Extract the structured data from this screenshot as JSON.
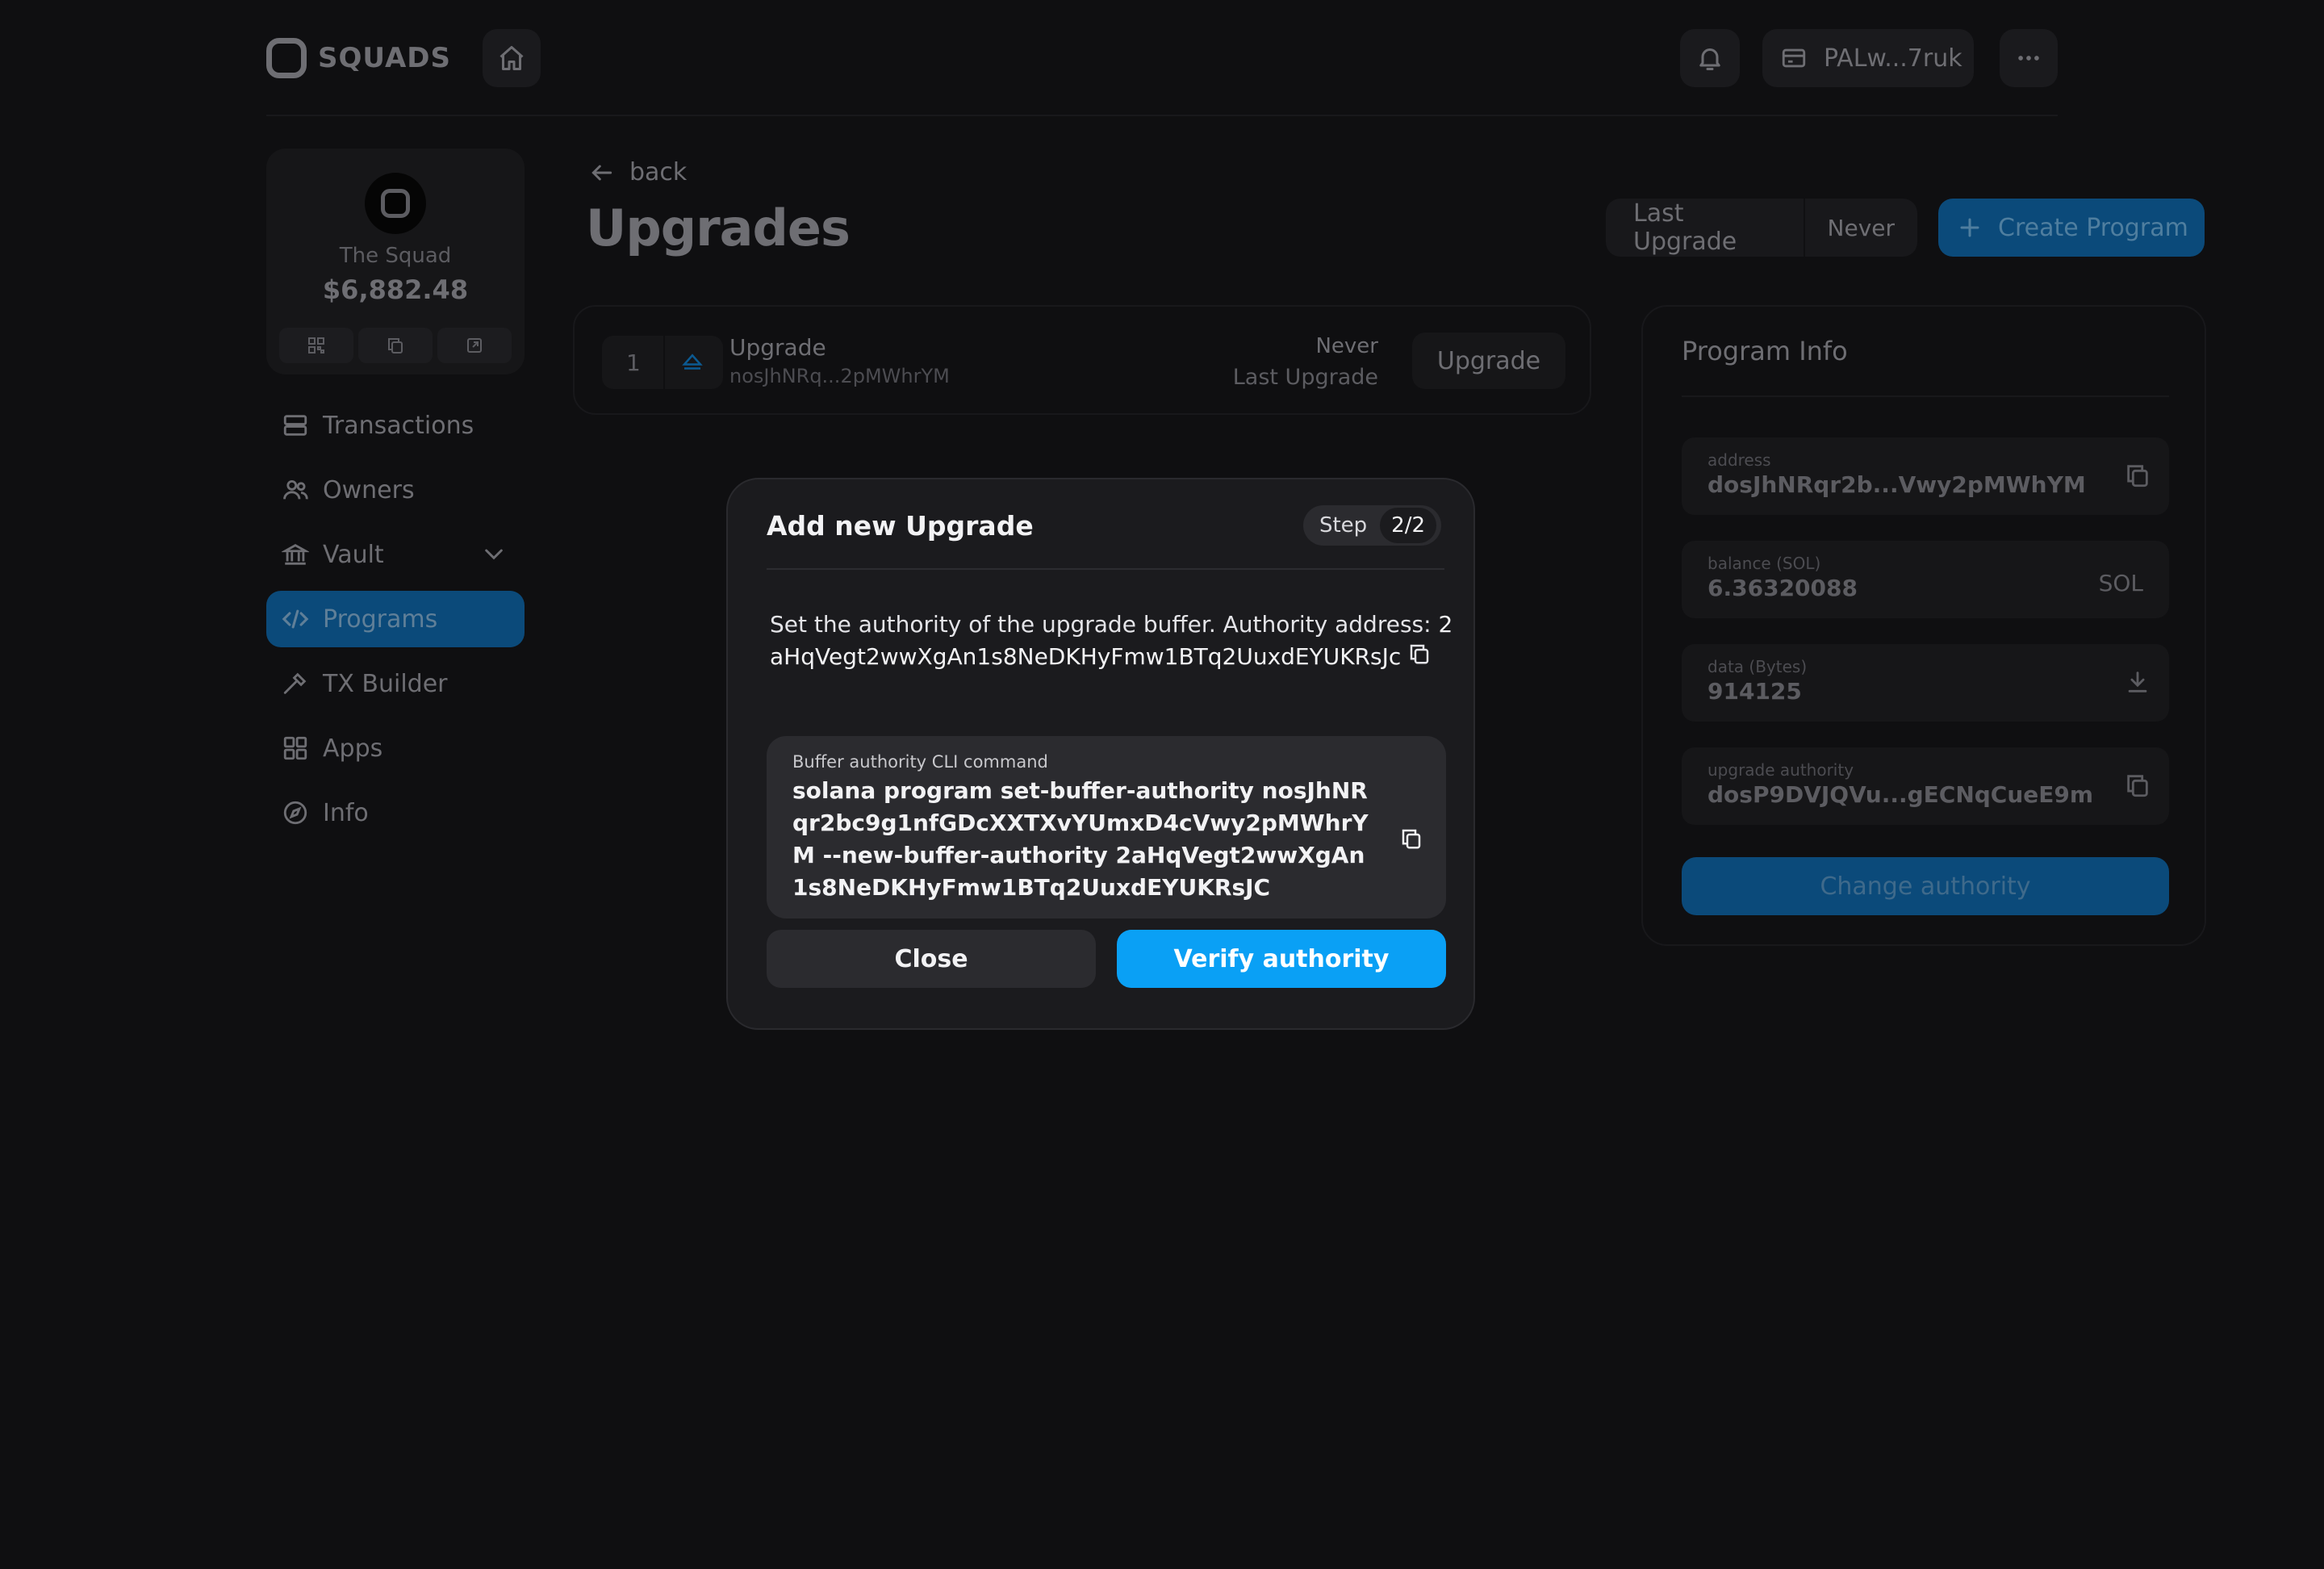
{
  "header": {
    "brand": "SQUADS",
    "wallet_label": "PALw...7ruk"
  },
  "squad": {
    "name": "The Squad",
    "balance": "$6,882.48"
  },
  "sidebar": {
    "items": [
      {
        "label": "Transactions",
        "icon": "transactions-icon"
      },
      {
        "label": "Owners",
        "icon": "owners-icon"
      },
      {
        "label": "Vault",
        "icon": "bank-icon"
      },
      {
        "label": "Programs",
        "icon": "code-icon",
        "active": true
      },
      {
        "label": "TX Builder",
        "icon": "hammer-icon"
      },
      {
        "label": "Apps",
        "icon": "grid-icon"
      },
      {
        "label": "Info",
        "icon": "compass-icon"
      }
    ]
  },
  "main": {
    "back_label": "back",
    "title": "Upgrades",
    "last_upgrade_label": "Last Upgrade",
    "last_upgrade_value": "Never",
    "create_program_label": "Create Program",
    "upgrade_row": {
      "index": "1",
      "label": "Upgrade",
      "address": "nosJhNRq...2pMWhrYM",
      "status": "Never",
      "status_label": "Last Upgrade",
      "button": "Upgrade"
    }
  },
  "program_info": {
    "title": "Program Info",
    "fields": [
      {
        "key": "address",
        "value": "dosJhNRqr2b...Vwy2pMWhYM"
      },
      {
        "key": "balance (SOL)",
        "value": "6.36320088",
        "unit": "SOL"
      },
      {
        "key": "data (Bytes)",
        "value": "914125"
      },
      {
        "key": "upgrade authority",
        "value": "dosP9DVJQVu...gECNqCueE9m"
      }
    ],
    "change_authority_label": "Change authority"
  },
  "modal": {
    "title": "Add new Upgrade",
    "step_label": "Step",
    "step_count": "2/2",
    "description": "Set the authority of the upgrade buffer. Authority address: ",
    "authority_address": "2aHqVegt2wwXgAn1s8NeDKHyFmw1BTq2UuxdEYUKRsJc",
    "cli_label": "Buffer authority CLI command",
    "cli_command": "solana program set-buffer-authority nosJhNRqr2bc9g1nfGDcXXTXvYUmxD4cVwy2pMWhrYM --new-buffer-authority 2aHqVegt2wwXgAn1s8NeDKHyFmw1BTq2UuxdEYUKRsJC",
    "close_label": "Close",
    "verify_label": "Verify authority"
  },
  "colors": {
    "accent": "#0aa0f5",
    "accent_dim": "#0b4a7a",
    "background": "#0f0f11",
    "modal_bg": "#1b1b1e"
  }
}
